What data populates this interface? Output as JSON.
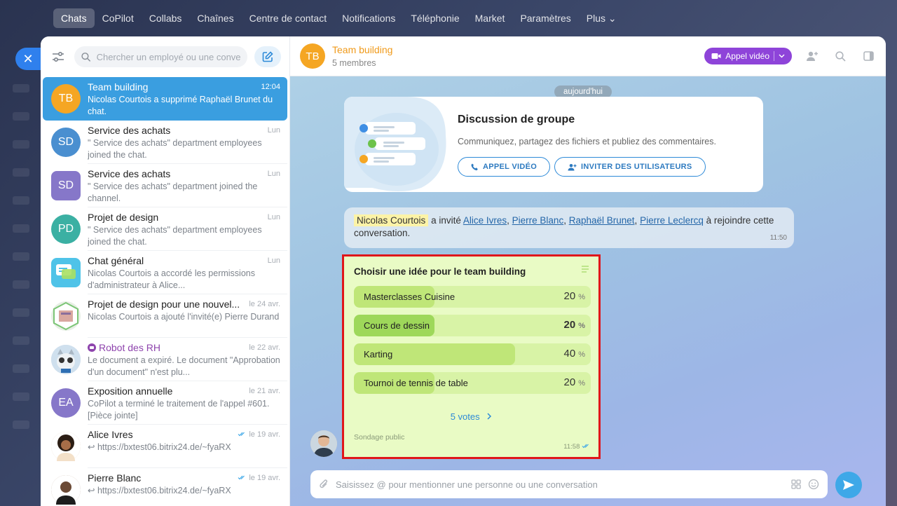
{
  "topnav": {
    "items": [
      {
        "label": "Chats",
        "active": true
      },
      {
        "label": "CoPilot"
      },
      {
        "label": "Collabs"
      },
      {
        "label": "Chaînes"
      },
      {
        "label": "Centre de contact"
      },
      {
        "label": "Notifications"
      },
      {
        "label": "Téléphonie"
      },
      {
        "label": "Market"
      },
      {
        "label": "Paramètres"
      },
      {
        "label": "Plus ⌄"
      }
    ]
  },
  "close_label": "✕",
  "sidebar": {
    "search_placeholder": "Chercher un employé ou une conversation",
    "chats": [
      {
        "initials": "TB",
        "color": "#f5a623",
        "name": "Team building",
        "time": "12:04",
        "msg": "Nicolas Courtois a supprimé Raphaël Brunet du chat.",
        "active": true
      },
      {
        "initials": "SD",
        "color": "#4a8fd0",
        "name": "Service des achats",
        "time": "Lun",
        "msg": "\" Service des achats\" department employees joined the chat."
      },
      {
        "initials": "SD",
        "color": "#8677c9",
        "name": "Service des achats",
        "time": "Lun",
        "msg": "\" Service des achats\" department joined the channel.",
        "square": true
      },
      {
        "initials": "PD",
        "color": "#3bb0a3",
        "name": "Projet de design",
        "time": "Lun",
        "msg": "\" Service des achats\" department employees joined the chat."
      },
      {
        "initials": "",
        "color": "#4fc3e8",
        "name": "Chat général",
        "time": "Lun",
        "msg": "Nicolas Courtois a accordé les permissions d'administrateur à Alice..."
      },
      {
        "initials": "",
        "color": "#e7efe5",
        "name": "Projet de design pour une nouvel...",
        "time": "le 24 avr.",
        "msg": "Nicolas Courtois a ajouté l'invité(e) Pierre Durand"
      },
      {
        "initials": "",
        "color": "#c9d6e3",
        "name": "Robot des RH",
        "time": "le 22 avr.",
        "msg": "Le document a expiré. Le document \"Approbation d'un document\" n'est plu...",
        "robot": true
      },
      {
        "initials": "EA",
        "color": "#8677c9",
        "name": "Exposition annuelle",
        "time": "le 21 avr.",
        "msg": "CoPilot a terminé le traitement de l'appel #601. [Pièce jointe]"
      },
      {
        "initials": "",
        "color": "#d8b89a",
        "name": "Alice Ivres",
        "time": "le 19 avr.",
        "msg": "↩ https://bxtest06.bitrix24.de/~fyaRX",
        "read": true
      },
      {
        "initials": "",
        "color": "#9a7a62",
        "name": "Pierre Blanc",
        "time": "le 19 avr.",
        "msg": "↩ https://bxtest06.bitrix24.de/~fyaRX",
        "read": true
      }
    ]
  },
  "chat": {
    "header": {
      "initials": "TB",
      "title": "Team building",
      "subtitle": "5 membres",
      "video_label": "Appel vidéo"
    },
    "date_label": "aujourd'hui",
    "group_card": {
      "title": "Discussion de groupe",
      "desc": "Communiquez, partagez des fichiers et publiez des commentaires.",
      "video_btn": "APPEL VIDÉO",
      "invite_btn": "INVITER DES UTILISATEURS"
    },
    "system_msg": {
      "actor": "Nicolas Courtois",
      "verb": "a invité",
      "users": [
        "Alice Ivres",
        "Pierre Blanc",
        "Raphaël Brunet",
        "Pierre Leclercq"
      ],
      "tail": "à rejoindre cette conversation.",
      "time": "11:50"
    },
    "poll": {
      "title": "Choisir une idée pour le team building",
      "options": [
        {
          "label": "Masterclasses Cuisine",
          "percent": 20
        },
        {
          "label": "Cours de dessin",
          "percent": 20,
          "selected": true
        },
        {
          "label": "Karting",
          "percent": 40
        },
        {
          "label": "Tournoi de tennis de table",
          "percent": 20
        }
      ],
      "pct_sign": "%",
      "votes": "5 votes",
      "type": "Sondage public",
      "time": "11:58"
    },
    "composer_placeholder": "Saisissez @ pour mentionner une personne ou une conversation"
  }
}
